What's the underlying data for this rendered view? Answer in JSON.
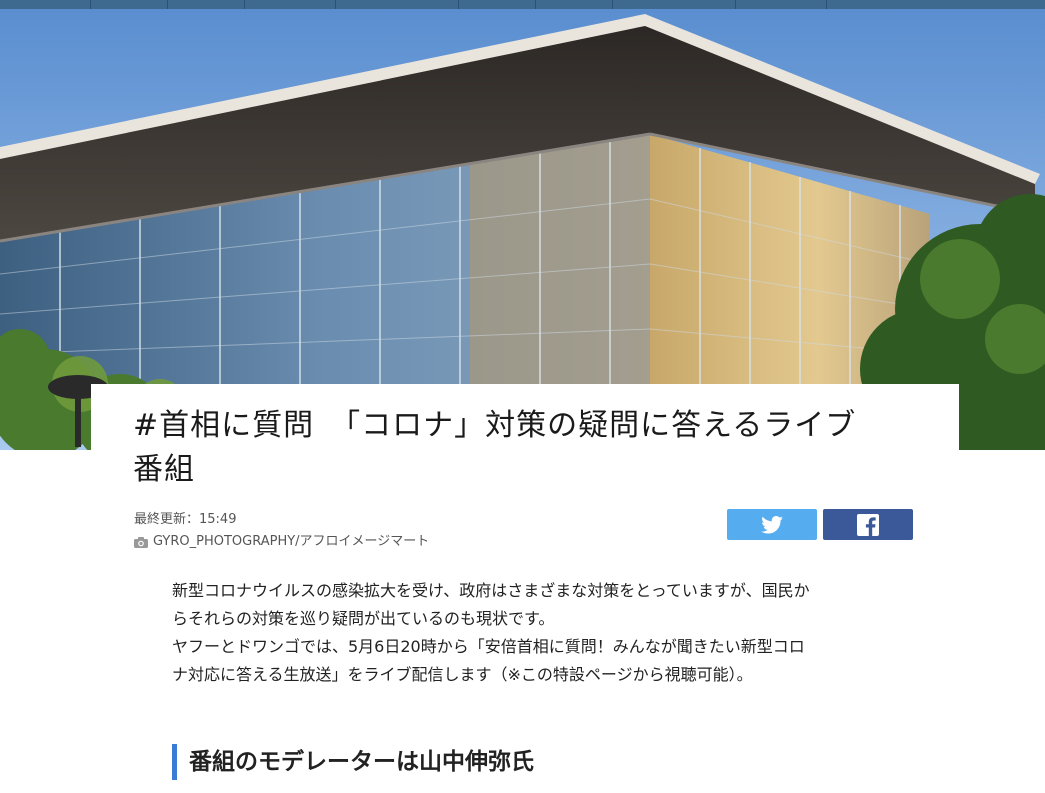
{
  "article": {
    "title_line1": "#首相に質問　「コロナ」対策の疑問に答えるライブ",
    "title_line2": "番組",
    "updated": "最終更新：15:49",
    "photo_credit": "GYRO_PHOTOGRAPHY/アフロイメージマート",
    "paragraph1_line1": "新型コロナウイルスの感染拡大を受け、政府はさまざまな対策をとっていますが、国民か",
    "paragraph1_line2": "らそれらの対策を巡り疑問が出ているのも現状です。",
    "paragraph2_line1": "ヤフーとドワンゴでは、5月6日20時から「安倍首相に質問！みんなが聞きたい新型コロ",
    "paragraph2_line2": "ナ対応に答える生放送」をライブ配信します（※この特設ページから視聴可能）。",
    "subheading": "番組のモデレーターは山中伸弥氏"
  },
  "share": {
    "twitter_icon": "twitter-bird-icon",
    "facebook_icon": "facebook-f-icon"
  },
  "colors": {
    "nav": "#3e6a8f",
    "twitter": "#55acee",
    "facebook": "#3b5998",
    "subhead_bar": "#3a7bd5"
  }
}
